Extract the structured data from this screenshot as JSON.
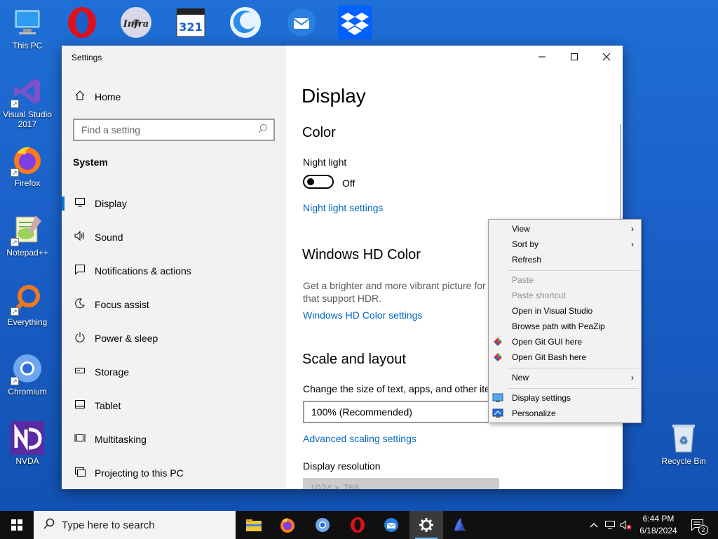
{
  "desktop": {
    "left_icons": [
      {
        "label": "This PC"
      },
      {
        "label": "Visual Studio 2017"
      },
      {
        "label": "Firefox"
      },
      {
        "label": "Notepad++"
      },
      {
        "label": "Everything"
      },
      {
        "label": "Chromium"
      },
      {
        "label": "NVDA"
      }
    ],
    "right_icons": [
      {
        "label": "Recycle Bin"
      }
    ],
    "top_icons": [
      {
        "name": "opera-icon"
      },
      {
        "name": "infrarecorder-icon"
      },
      {
        "name": "media-player-classic-icon"
      },
      {
        "name": "glary-utilities-icon"
      },
      {
        "name": "thunderbird-icon"
      },
      {
        "name": "dropbox-icon"
      }
    ]
  },
  "window": {
    "title": "Settings",
    "sidebar": {
      "home_label": "Home",
      "search_placeholder": "Find a setting",
      "section_label": "System",
      "items": [
        {
          "label": "Display",
          "icon": "monitor-icon"
        },
        {
          "label": "Sound",
          "icon": "speaker-icon"
        },
        {
          "label": "Notifications & actions",
          "icon": "notification-icon"
        },
        {
          "label": "Focus assist",
          "icon": "moon-icon"
        },
        {
          "label": "Power & sleep",
          "icon": "power-icon"
        },
        {
          "label": "Storage",
          "icon": "storage-icon"
        },
        {
          "label": "Tablet",
          "icon": "tablet-icon"
        },
        {
          "label": "Multitasking",
          "icon": "multitasking-icon"
        },
        {
          "label": "Projecting to this PC",
          "icon": "projector-icon"
        }
      ]
    },
    "content": {
      "page_title": "Display",
      "color_heading": "Color",
      "night_light_label": "Night light",
      "night_light_state": "Off",
      "night_light_link": "Night light settings",
      "hd_heading": "Windows HD Color",
      "hd_description": "Get a brighter and more vibrant picture for that support HDR.",
      "hd_link": "Windows HD Color settings",
      "scale_heading": "Scale and layout",
      "scale_label": "Change the size of text, apps, and other ite",
      "scale_value": "100% (Recommended)",
      "advanced_link": "Advanced scaling settings",
      "resolution_label": "Display resolution",
      "resolution_value": "1024 × 768"
    }
  },
  "context_menu": {
    "items": [
      {
        "label": "View",
        "submenu": true,
        "disabled": false
      },
      {
        "label": "Sort by",
        "submenu": true,
        "disabled": false
      },
      {
        "label": "Refresh",
        "submenu": false,
        "disabled": false
      },
      {
        "label": "Paste",
        "submenu": false,
        "disabled": true
      },
      {
        "label": "Paste shortcut",
        "submenu": false,
        "disabled": true
      },
      {
        "label": "Open in Visual Studio",
        "submenu": false,
        "disabled": false
      },
      {
        "label": "Browse path with PeaZip",
        "submenu": false,
        "disabled": false
      },
      {
        "label": "Open Git GUI here",
        "submenu": false,
        "disabled": false,
        "icon": "git-icon"
      },
      {
        "label": "Open Git Bash here",
        "submenu": false,
        "disabled": false,
        "icon": "git-icon"
      },
      {
        "label": "New",
        "submenu": true,
        "disabled": false
      },
      {
        "label": "Display settings",
        "submenu": false,
        "disabled": false,
        "icon": "display-settings-icon"
      },
      {
        "label": "Personalize",
        "submenu": false,
        "disabled": false,
        "icon": "personalize-icon"
      }
    ]
  },
  "taskbar": {
    "search_placeholder": "Type here to search",
    "apps": [
      {
        "name": "file-explorer-icon"
      },
      {
        "name": "firefox-icon"
      },
      {
        "name": "chromium-icon"
      },
      {
        "name": "opera-icon"
      },
      {
        "name": "thunderbird-icon"
      },
      {
        "name": "settings-icon"
      },
      {
        "name": "nvda-icon"
      }
    ],
    "time": "6:44 PM",
    "date": "6/18/2024",
    "notification_count": "2"
  },
  "colors": {
    "accent": "#0078d7",
    "link": "#0067c0",
    "desktop": "#1a5fc7",
    "taskbar": "#101010"
  }
}
